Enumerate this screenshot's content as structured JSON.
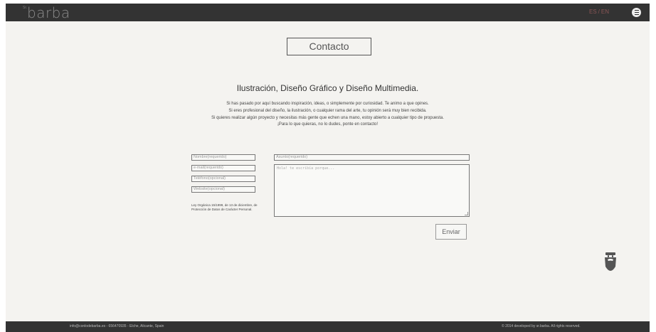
{
  "header": {
    "logo_sup": "Sr.",
    "logo": "barba",
    "lang_es": "ES",
    "lang_sep": "/",
    "lang_en": "EN"
  },
  "page": {
    "title": "Contacto",
    "heading": "Ilustración, Diseño Gráfico y Diseño Multimedia.",
    "intro": [
      "Si has pasado por aquí buscando inspiración, ideas, o simplemente por curiosidad. Te animo a que opines.",
      "Si eres profesional del diseño, la ilustración, o cualquier rama del arte, tu opinión será muy bien recibida.",
      "Si quieres realizar algún proyecto y necesitas más gente que echen una mano, estoy abierto a cualquier tipo de propuesta.",
      "¡Para lo que quieras, no lo dudes, ponte en contacto!"
    ]
  },
  "form": {
    "name_placeholder": "Nombre(requerido)",
    "email_placeholder": "e-mail(requerido)",
    "phone_placeholder": "Teléfono(opcional)",
    "website_placeholder": "Website(opcional)",
    "subject_placeholder": "Asunto(requerido)",
    "message_placeholder": "Hola! te escribía porque...",
    "legal_text": "Ley Orgánica 15/1999, de 13 de diciembre, de Protección de Datos de Carácter Personal.",
    "send_label": "Enviar"
  },
  "footer": {
    "contact": "info@conlodebarba.es - 656470935 - Elche, Alicante, Spain",
    "copyright": "© 2014 developed by sr.barba. All rights reserved."
  },
  "icons": {
    "menu": "menu-icon",
    "mascot": "beard-mascot-icon"
  }
}
